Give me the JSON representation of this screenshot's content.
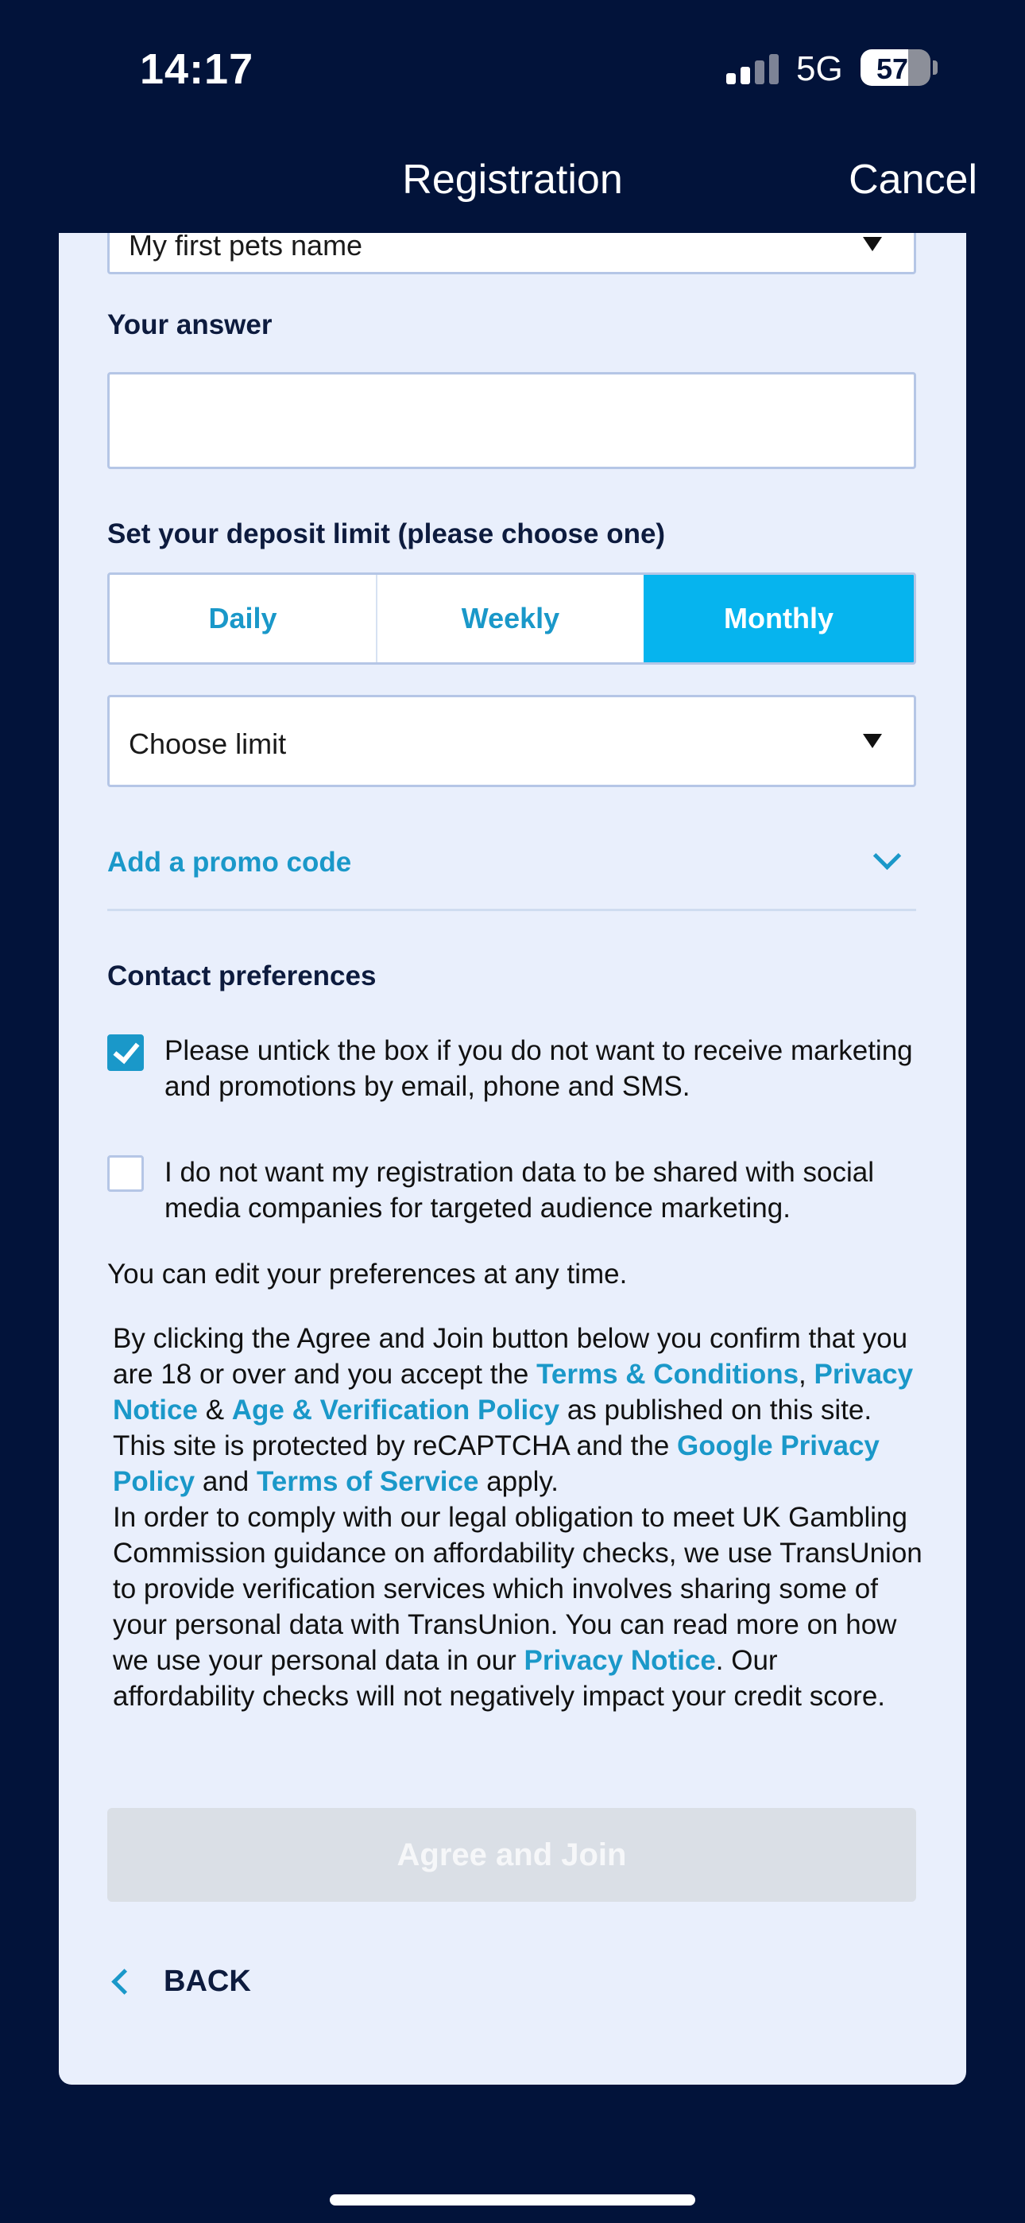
{
  "status_bar": {
    "time": "14:17",
    "network": "5G",
    "battery": "57"
  },
  "nav": {
    "title": "Registration",
    "cancel": "Cancel"
  },
  "form": {
    "security_question_value": "My first pets name",
    "answer_label": "Your answer",
    "answer_value": "",
    "deposit_label": "Set your deposit limit (please choose one)",
    "deposit_options": [
      "Daily",
      "Weekly",
      "Monthly"
    ],
    "deposit_selected": "Monthly",
    "limit_select_value": "Choose limit",
    "promo_label": "Add a promo code",
    "contact_title": "Contact preferences",
    "marketing_checkbox": {
      "checked": true,
      "text": "Please untick the box if you do not want to receive marketing and promotions by email, phone and SMS."
    },
    "social_checkbox": {
      "checked": false,
      "text": "I do not want my registration data to be shared with social media companies for targeted audience marketing."
    },
    "edit_note": "You can edit your preferences at any time.",
    "legal": {
      "p1_a": "By clicking the Agree and Join button below you confirm that you are 18 or over and you accept the ",
      "terms_link": "Terms & Conditions",
      "comma": ",",
      "privacy_link": "Privacy Notice",
      "amp": " & ",
      "age_link": "Age & Verification Policy",
      "p1_b": " as published on this site. This site is protected by reCAPTCHA and the ",
      "google_privacy_link": "Google Privacy Policy",
      "and": " and ",
      "tos_link": "Terms of Service",
      "apply": " apply.",
      "p2_a": "In order to comply with our legal obligation to meet UK Gambling Commission guidance on affordability checks, we use TransUnion to provide verification services which involves sharing some of your personal data with TransUnion. You can read more on how we use your personal data in our ",
      "privacy_link_2": "Privacy Notice",
      "p2_b": ". Our affordability checks will not negatively impact your credit score."
    },
    "submit_label": "Agree and Join",
    "back_label": "BACK"
  },
  "colors": {
    "background": "#02133a",
    "card": "#e9effc",
    "accent": "#06b4ee",
    "link": "#1a98c9"
  }
}
